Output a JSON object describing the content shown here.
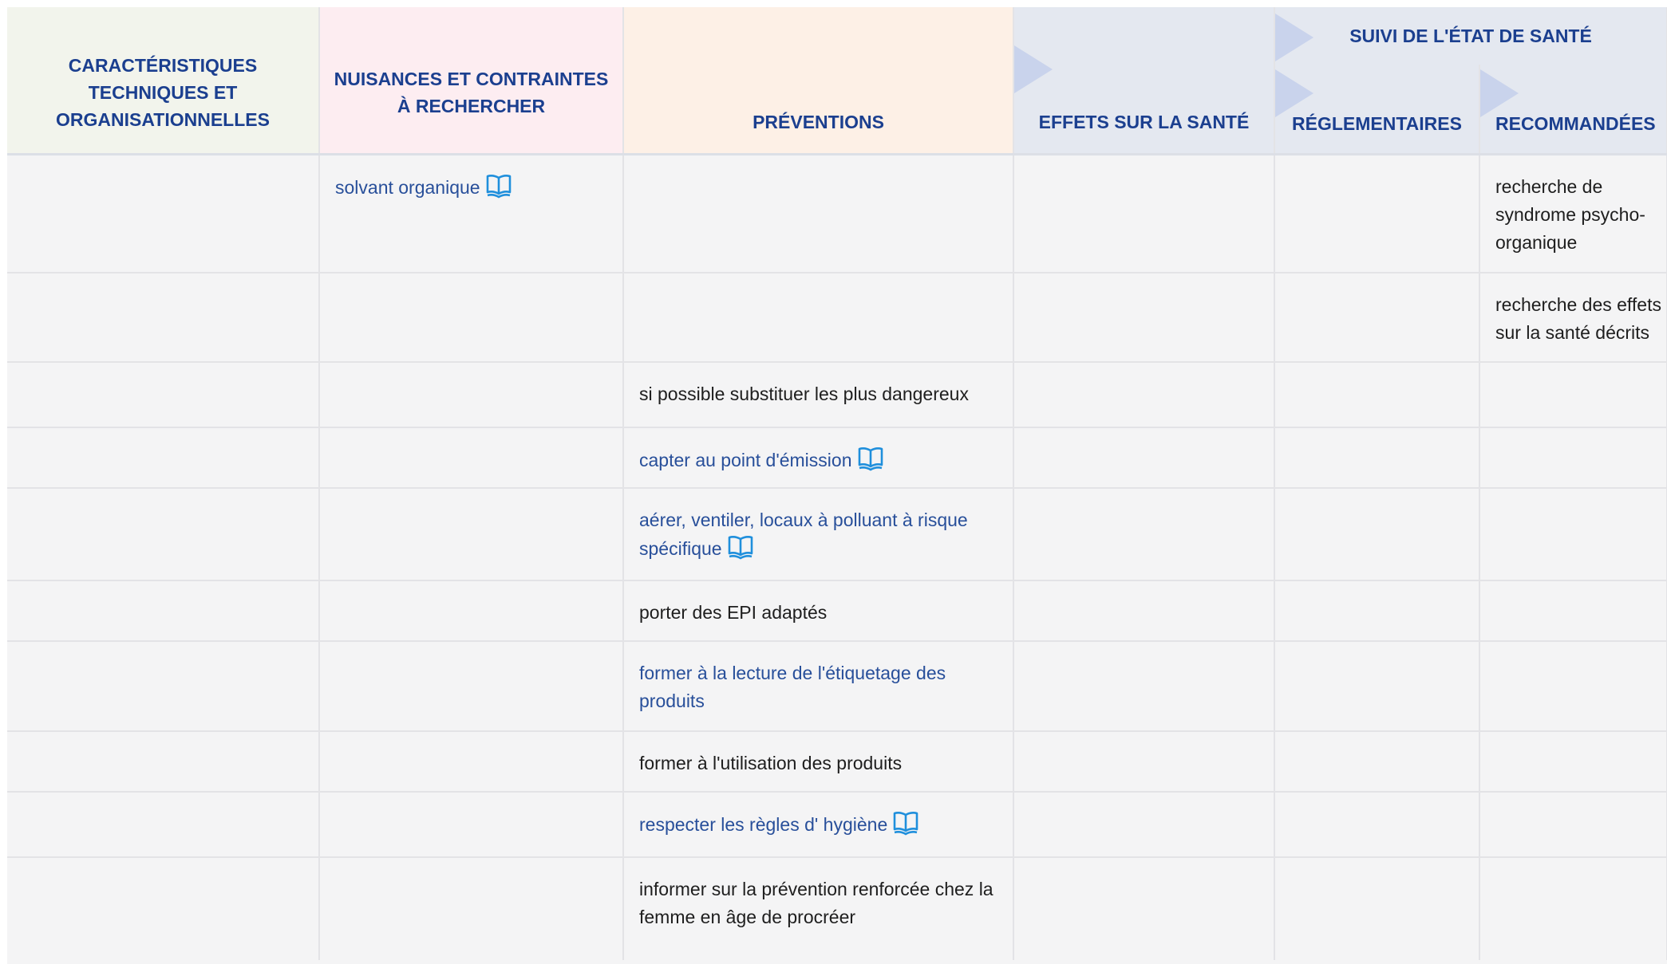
{
  "header": {
    "tech": "CARACTÉRISTIQUES TECHNIQUES ET ORGANISATIONNELLES",
    "nuisances": "NUISANCES ET CONTRAINTES À RECHERCHER",
    "preventions": "PRÉVENTIONS",
    "effets": "EFFETS SUR LA SANTÉ",
    "suivi": "SUIVI DE L'ÉTAT DE SANTÉ",
    "reglementaires": "RÉGLEMENTAIRES",
    "recommandees": "RECOMMANDÉES"
  },
  "rows": [
    {
      "nuisance": "solvant organique",
      "nuisance_link": true,
      "prevention": "",
      "recommandee": "recherche de syndrome psycho-organique"
    },
    {
      "nuisance": "",
      "prevention": "",
      "recommandee": "recherche des effets sur la santé décrits"
    },
    {
      "nuisance": "",
      "prevention": "si possible substituer les plus dangereux",
      "prevention_link": false,
      "recommandee": ""
    },
    {
      "nuisance": "",
      "prevention": "capter au point d'émission",
      "prevention_link": true,
      "recommandee": ""
    },
    {
      "nuisance": "",
      "prevention": "aérer, ventiler, locaux à polluant à risque spécifique",
      "prevention_link": true,
      "recommandee": ""
    },
    {
      "nuisance": "",
      "prevention": "porter des EPI adaptés",
      "prevention_link": false,
      "recommandee": ""
    },
    {
      "nuisance": "",
      "prevention": "former à la lecture de l'étiquetage des produits",
      "prevention_link": true,
      "book": false,
      "recommandee": ""
    },
    {
      "nuisance": "",
      "prevention": "former à l'utilisation des produits",
      "prevention_link": false,
      "recommandee": ""
    },
    {
      "nuisance": "",
      "prevention": "respecter les règles d' hygiène",
      "prevention_link": true,
      "recommandee": ""
    },
    {
      "nuisance": "",
      "prevention": "informer sur la prévention renforcée chez la femme en âge de procréer",
      "prevention_link": false,
      "recommandee": ""
    }
  ],
  "icons": {
    "book": "book-open-icon"
  },
  "colors": {
    "header_text": "#1b3f8f",
    "link_text": "#284f9a",
    "icon_blue": "#1f8fdc",
    "tech_bg": "#f2f4ec",
    "nuisance_bg": "#fdedf1",
    "prevention_bg": "#fdf0e6",
    "sante_bg": "#e4e8f0"
  }
}
